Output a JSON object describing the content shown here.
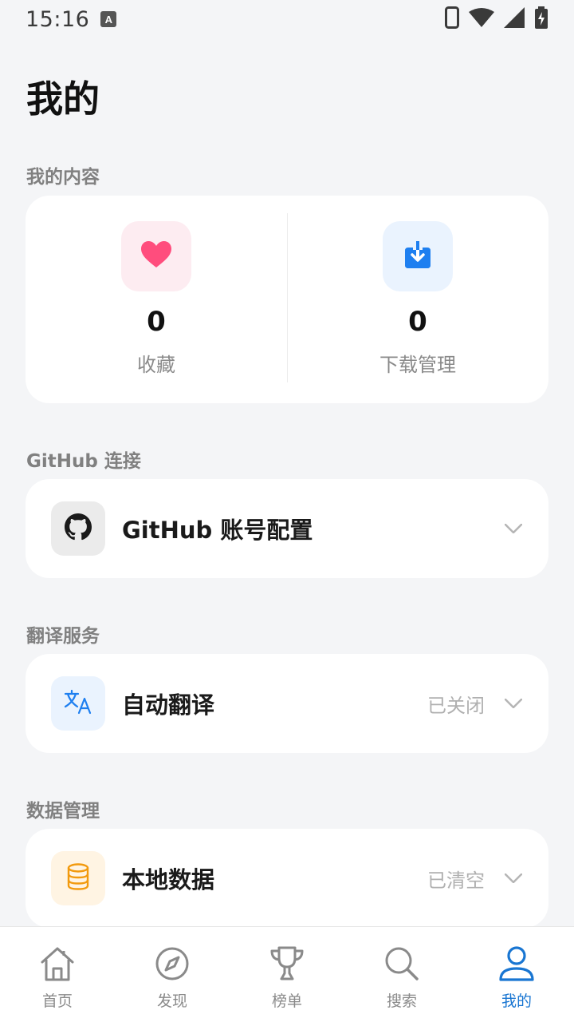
{
  "status_bar": {
    "time": "15:16",
    "notification_letter": "A"
  },
  "page_title": "我的",
  "sections": {
    "my_content": {
      "title": "我的内容",
      "items": [
        {
          "count": "0",
          "label": "收藏",
          "icon": "heart-icon",
          "color": "#ff4d7d",
          "bg": "#fdecf1"
        },
        {
          "count": "0",
          "label": "下载管理",
          "icon": "download-icon",
          "color": "#1e7ff0",
          "bg": "#eaf3fe"
        }
      ]
    },
    "github": {
      "title": "GitHub 连接",
      "row_label": "GitHub 账号配置",
      "icon": "github-icon"
    },
    "translate": {
      "title": "翻译服务",
      "row_label": "自动翻译",
      "status": "已关闭",
      "icon": "translate-icon"
    },
    "data": {
      "title": "数据管理",
      "row_label": "本地数据",
      "status": "已清空",
      "icon": "database-icon"
    }
  },
  "bottom_nav": {
    "items": [
      {
        "label": "首页",
        "icon": "home-icon"
      },
      {
        "label": "发现",
        "icon": "compass-icon"
      },
      {
        "label": "榜单",
        "icon": "trophy-icon"
      },
      {
        "label": "搜索",
        "icon": "search-icon"
      },
      {
        "label": "我的",
        "icon": "person-icon",
        "active": true
      }
    ],
    "active_color": "#1976d2"
  }
}
